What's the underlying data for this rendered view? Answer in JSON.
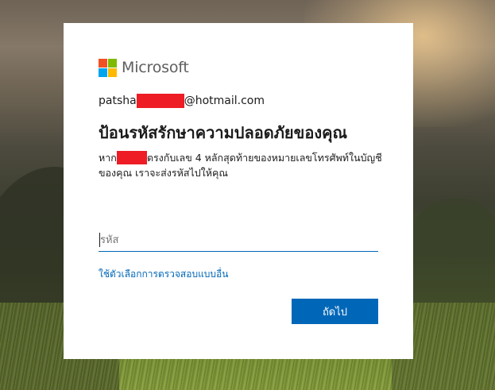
{
  "brand": {
    "name": "Microsoft",
    "logo_colors": [
      "#f25022",
      "#7fba00",
      "#00a4ef",
      "#ffb900"
    ]
  },
  "identity": {
    "prefix": "patsha",
    "suffix": "@hotmail.com",
    "redaction_color": "#ee1c25"
  },
  "title": "ป้อนรหัสรักษาความปลอดภัยของคุณ",
  "description": {
    "before_redaction": "หาก",
    "after_redaction": "ตรงกับเลข 4 หลักสุดท้ายของหมายเลขโทรศัพท์ในบัญชีของคุณ เราจะส่งรหัสไปให้คุณ"
  },
  "code_input": {
    "placeholder": "รหัส",
    "value": ""
  },
  "alt_link": "ใช้ตัวเลือกการตรวจสอบแบบอื่น",
  "next_button": "ถัดไป",
  "colors": {
    "accent": "#0067b8",
    "text": "#1b1b1b"
  }
}
